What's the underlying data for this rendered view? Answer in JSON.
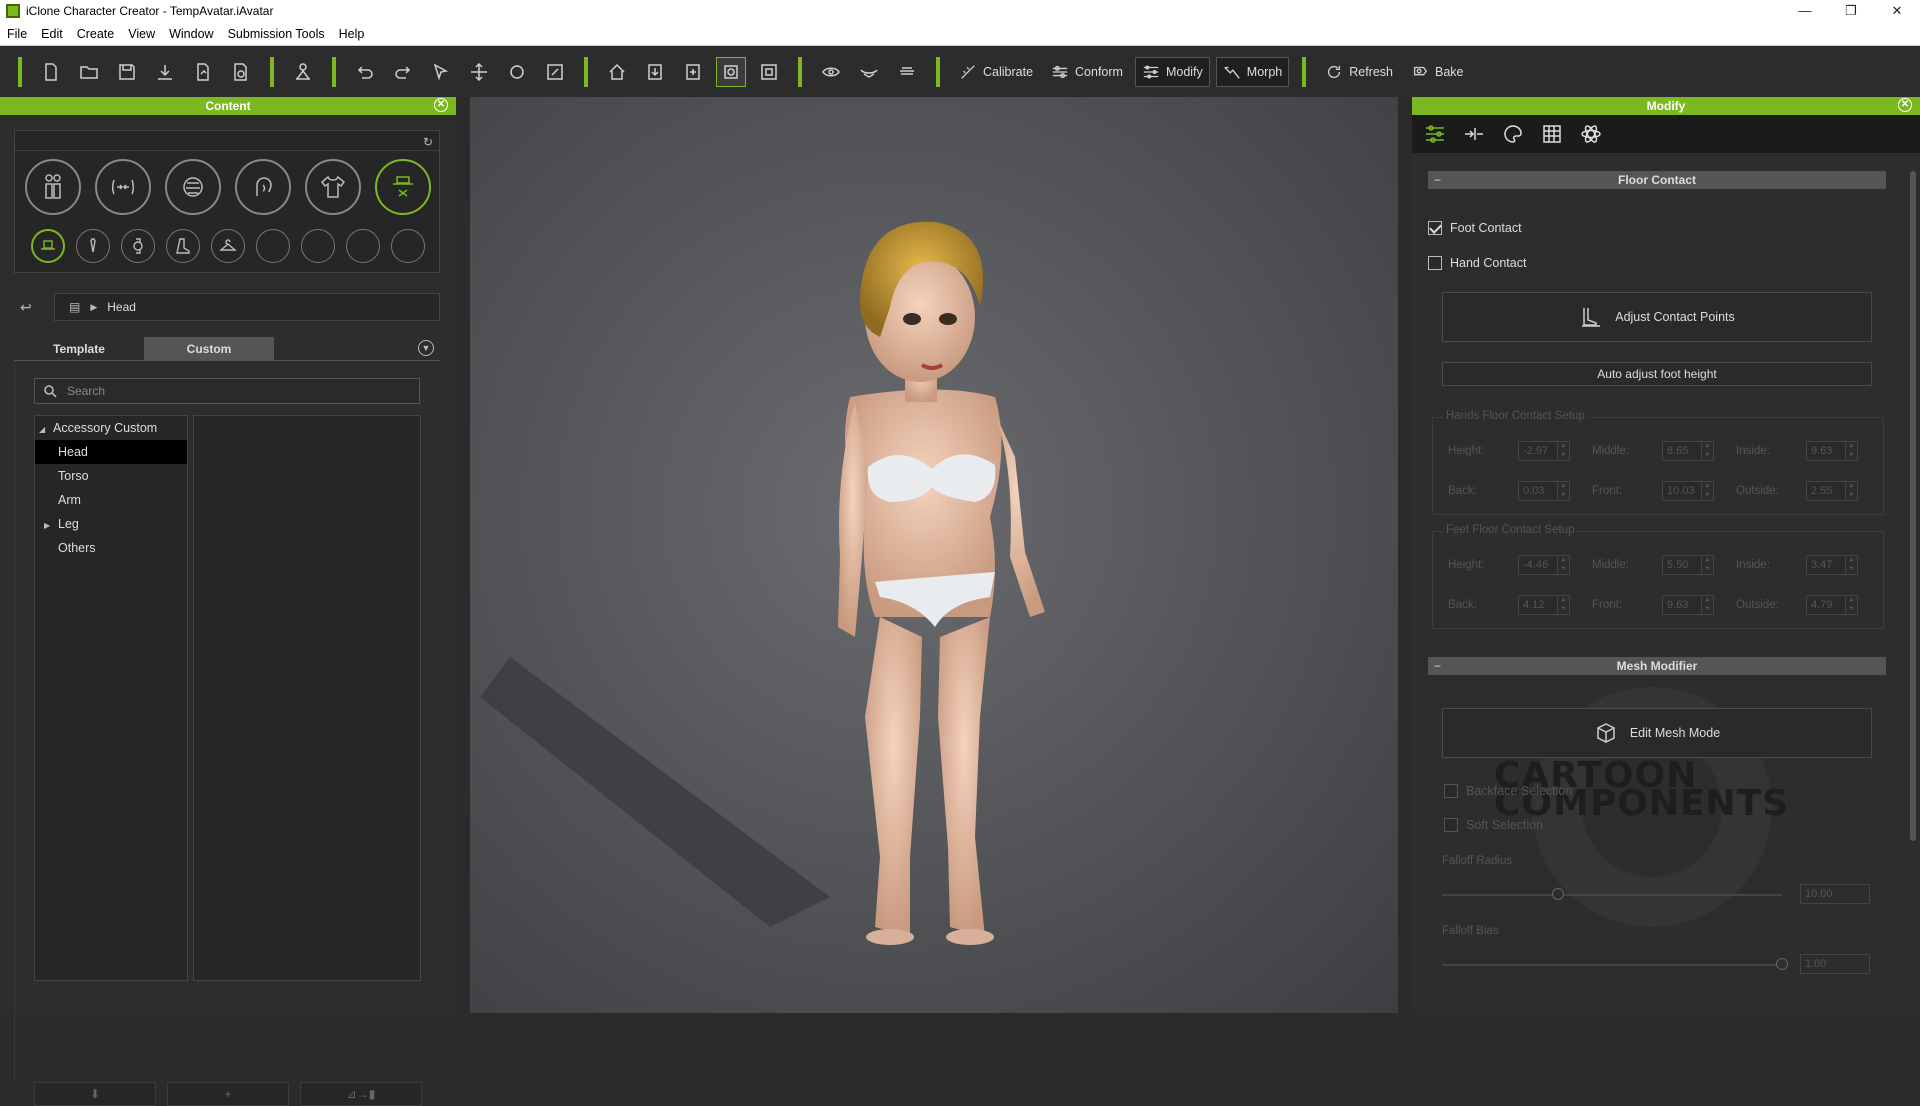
{
  "window": {
    "title": "iClone Character Creator - TempAvatar.iAvatar",
    "controls": [
      "—",
      "❐",
      "✕"
    ]
  },
  "menu": [
    "File",
    "Edit",
    "Create",
    "View",
    "Window",
    "Submission Tools",
    "Help"
  ],
  "toolbar": {
    "calibrate": "Calibrate",
    "conform": "Conform",
    "modify": "Modify",
    "morph": "Morph",
    "refresh": "Refresh",
    "bake": "Bake"
  },
  "content": {
    "title": "Content",
    "breadcrumb": "Head",
    "tabs": [
      "Template",
      "Custom"
    ],
    "search_placeholder": "Search",
    "tree": {
      "root": "Accessory Custom",
      "items": [
        "Head",
        "Torso",
        "Arm",
        "Leg",
        "Others"
      ]
    },
    "bottom_buttons": [
      "⬇",
      "+",
      "⊿→▮"
    ]
  },
  "modify": {
    "title": "Modify",
    "floor_contact": {
      "title": "Floor Contact",
      "foot_contact": "Foot Contact",
      "hand_contact": "Hand Contact",
      "adjust_points": "Adjust Contact Points",
      "auto_adjust": "Auto adjust foot height",
      "hands_group": "Hands Floor Contact Setup",
      "hands": {
        "height_label": "Height:",
        "height": "-2.97",
        "middle_label": "Middle:",
        "middle": "8.65",
        "inside_label": "Inside:",
        "inside": "9.63",
        "back_label": "Back:",
        "back": "0.03",
        "front_label": "Front:",
        "front": "10.03",
        "outside_label": "Outside:",
        "outside": "2.55"
      },
      "feet_group": "Feet Floor Contact Setup",
      "feet": {
        "height_label": "Height:",
        "height": "-4.46",
        "middle_label": "Middle:",
        "middle": "5.50",
        "inside_label": "Inside:",
        "inside": "3.47",
        "back_label": "Back:",
        "back": "4.12",
        "front_label": "Front:",
        "front": "9.63",
        "outside_label": "Outside:",
        "outside": "4.79"
      }
    },
    "mesh_modifier": {
      "title": "Mesh Modifier",
      "edit_mode": "Edit Mesh Mode",
      "backface": "Backface Selection",
      "soft": "Soft Selection",
      "falloff_radius": "Falloff Radius",
      "falloff_radius_value": "10.00",
      "falloff_bias": "Falloff Bias",
      "falloff_bias_value": "1.00"
    },
    "watermark": "CARTOON COMPONENTS"
  },
  "colors": {
    "accent": "#7cb820",
    "panel": "#2d2d2d"
  },
  "checks": {
    "foot_contact": true,
    "hand_contact": false
  }
}
